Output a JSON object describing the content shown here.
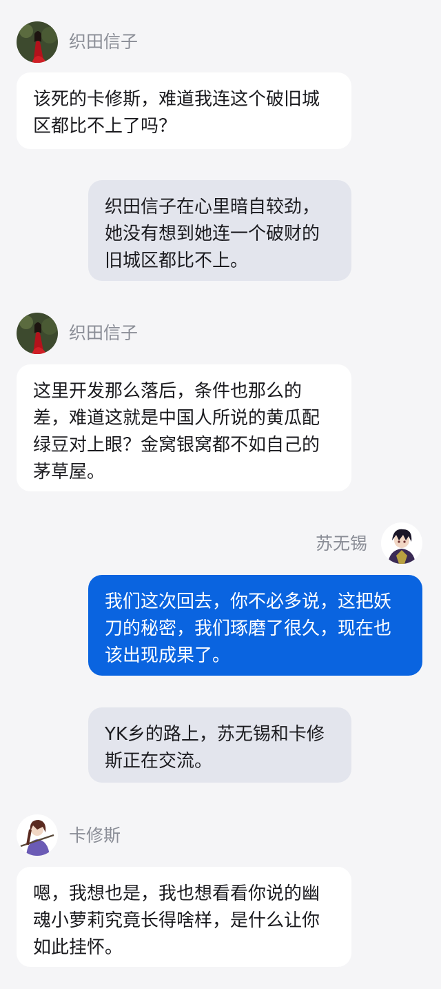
{
  "conversation": {
    "messages": [
      {
        "type": "left",
        "sender": "织田信子",
        "avatar": "red-dress-woman-avatar",
        "text": "该死的卡修斯，难道我连这个破旧城区都比不上了吗？"
      },
      {
        "type": "narration",
        "text": "织田信子在心里暗自较劲，她没有想到她连一个破财的旧城区都比不上。"
      },
      {
        "type": "left",
        "sender": "织田信子",
        "avatar": "red-dress-woman-avatar",
        "text": "这里开发那么落后，条件也那么的差，难道这就是中国人所说的黄瓜配绿豆对上眼？金窝银窝都不如自己的茅草屋。"
      },
      {
        "type": "right",
        "sender": "苏无锡",
        "avatar": "anime-man-avatar",
        "text": "我们这次回去，你不必多说，这把妖刀的秘密，我们琢磨了很久，现在也该出现成果了。"
      },
      {
        "type": "narration",
        "text": "YK乡的路上，苏无锡和卡修斯正在交流。"
      },
      {
        "type": "left",
        "sender": "卡修斯",
        "avatar": "purple-swordsman-avatar",
        "text": "嗯，我想也是，我也想看看你说的幽魂小萝莉究竟长得啥样，是什么让你如此挂怀。"
      }
    ]
  },
  "colors": {
    "background": "#f5f5f7",
    "left_bubble": "#ffffff",
    "narration_bubble": "#e3e5ed",
    "right_bubble": "#0a64e0",
    "sender_name": "#8a8d96"
  }
}
